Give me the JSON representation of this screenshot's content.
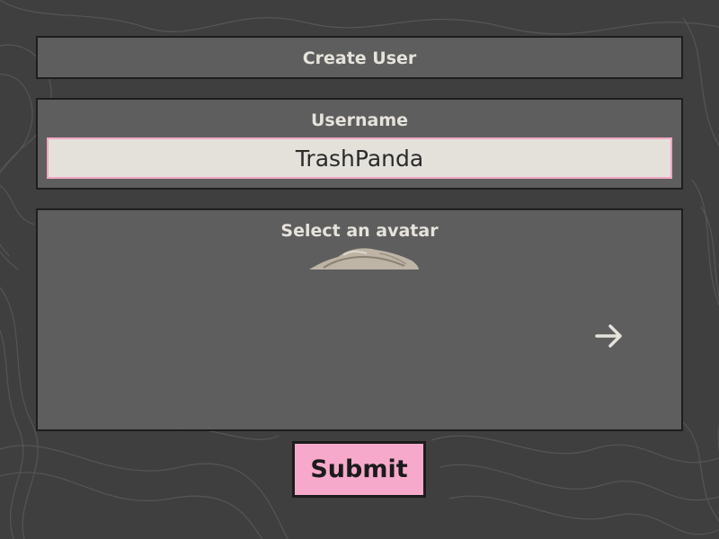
{
  "form": {
    "title": "Create User",
    "username_label": "Username",
    "username_value": "TrashPanda",
    "avatar_label": "Select an avatar",
    "next_icon": "arrow-right-icon",
    "submit_label": "Submit"
  },
  "colors": {
    "background": "#3f3f3f",
    "panel": "#5e5e5e",
    "panel_border": "#1e1e1e",
    "text": "#e6e3dc",
    "input_background": "#e4e1db",
    "accent_pink": "#f7a9cc"
  }
}
